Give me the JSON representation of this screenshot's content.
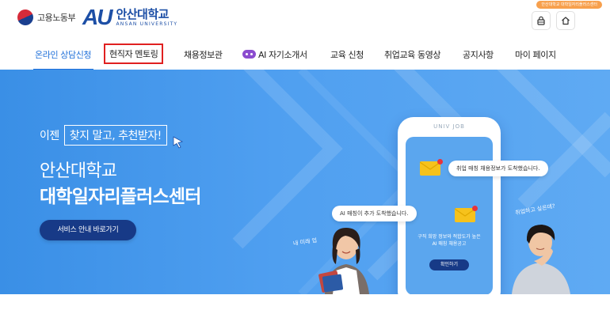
{
  "header": {
    "ministry": "고용노동부",
    "univ_mark": "AU",
    "univ_name": "안산대학교",
    "univ_en": "ANSAN UNIVERSITY",
    "top_badge": "안산대학교 대학일자리플러스센터",
    "icons": [
      "lock-icon",
      "home-icon"
    ]
  },
  "nav": {
    "items": [
      "온라인 상담신청",
      "현직자 멘토링",
      "채용정보관",
      "AI 자기소개서",
      "교육 신청",
      "취업교육 동영상",
      "공지사항",
      "마이 페이지"
    ],
    "active_index": 0,
    "highlighted_index": 1
  },
  "hero": {
    "lead_prefix": "이젠",
    "lead_box": "찾지 말고, 추천받자!",
    "title1": "안산대학교",
    "title2": "대학일자리플러스센터",
    "button": "서비스 안내 바로가기",
    "phone_label": "UNIV JOB",
    "bubble_right": "취업 매칭 채용정보가 도착했습니다.",
    "bubble_left": "AI 매칭이 추가 도착했습니다.",
    "screen_text": "구직 희망 정보와 적합도가 높은 AI 매칭 채용공고",
    "screen_button": "확인하기",
    "scribble_left": "내 미래 업",
    "scribble_right": "취업하고 싶은데?"
  },
  "colors": {
    "brand": "#1d4fa6",
    "nav_active": "#1e6fd9",
    "highlight_box": "#e02020",
    "hero_bg": "#4f9ff0",
    "button_dark": "#173a87"
  }
}
